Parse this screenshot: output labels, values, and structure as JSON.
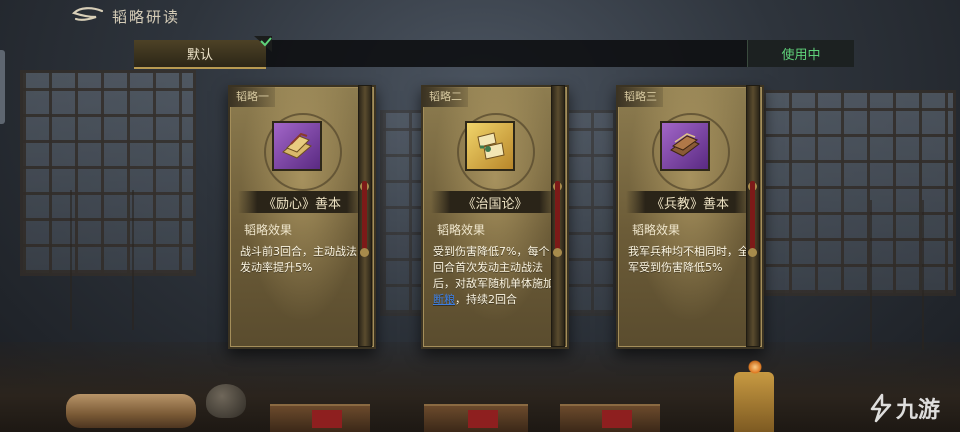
{
  "header": {
    "title": "韬略研读",
    "back_icon": "back-arrow-icon"
  },
  "presets": {
    "default_label": "默认",
    "status_label": "使用中"
  },
  "cards": [
    {
      "tag": "韬略一",
      "name": "《励心》善本",
      "effect_label": "韬略效果",
      "effect_text": "战斗前3回合，主动战法发动率提升5%",
      "icon": "scroll-book-icon",
      "icon_bg": "purple"
    },
    {
      "tag": "韬略二",
      "name": "《治国论》",
      "effect_label": "韬略效果",
      "effect_before": "受到伤害降低7%，每个回合首次发动主动战法后，对敌军随机单体施加",
      "effect_link": "断粮",
      "effect_after": "，持续2回合",
      "icon": "bamboo-scroll-icon",
      "icon_bg": "gold"
    },
    {
      "tag": "韬略三",
      "name": "《兵教》善本",
      "effect_label": "韬略效果",
      "effect_text": "我军兵种均不相同时，全军受到伤害降低5%",
      "icon": "book-stack-icon",
      "icon_bg": "purple"
    }
  ],
  "watermark": {
    "text": "九游"
  },
  "colors": {
    "in_use": "#5fd27a",
    "link": "#3d7ee0",
    "card_gold": "#8e7d50"
  }
}
